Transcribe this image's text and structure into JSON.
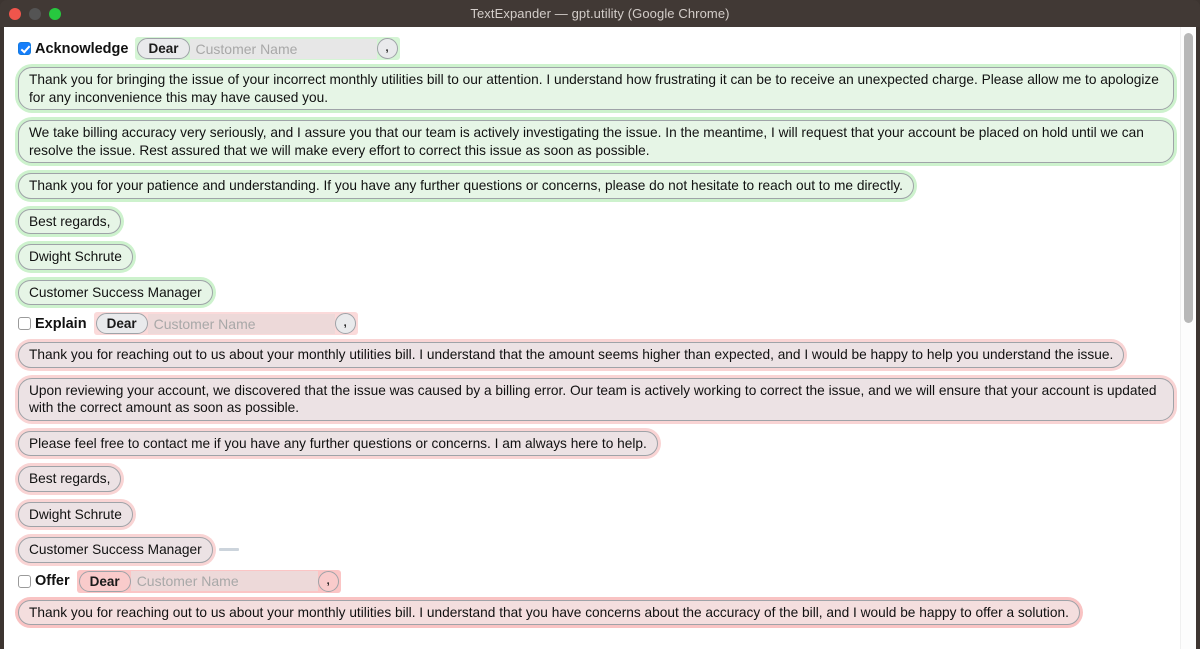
{
  "window": {
    "title": "TextExpander — gpt.utility (Google Chrome)",
    "controls": [
      "close",
      "minimize",
      "maximize"
    ]
  },
  "colors": {
    "titlebar_bg": "#413935",
    "accent_checkbox": "#157efb",
    "highlight_green": "#cdf2cd",
    "highlight_pink": "#f9c3c3",
    "bubble_bg": "#e9eaec"
  },
  "scrollbar": {
    "visible": true,
    "orientation": "vertical"
  },
  "sections": [
    {
      "id": "acknowledge",
      "label": "Acknowledge",
      "checked": true,
      "highlight": "green",
      "salutation": {
        "greeting_pill": "Dear",
        "name_placeholder": "Customer Name",
        "name_value": "",
        "punctuation_pill": ","
      },
      "has_trailing_dash": false,
      "blocks": [
        {
          "text": "Thank you for bringing the issue of your incorrect monthly utilities bill to our attention. I understand how frustrating it can be to receive an unexpected charge. Please allow me to apologize for any inconvenience this may have caused you.",
          "width": "full"
        },
        {
          "text": "We take billing accuracy very seriously, and I assure you that our team is actively investigating the issue. In the meantime, I will request that your account be placed on hold until we can resolve the issue. Rest assured that we will make every effort to correct this issue as soon as possible.",
          "width": "full"
        },
        {
          "text": "Thank you for your patience and understanding. If you have any further questions or concerns, please do not hesitate to reach out to me directly.",
          "width": "auto"
        },
        {
          "text": "Best regards,",
          "width": "auto"
        },
        {
          "text": "Dwight Schrute",
          "width": "auto"
        },
        {
          "text": "Customer Success Manager",
          "width": "auto"
        }
      ]
    },
    {
      "id": "explain",
      "label": "Explain",
      "checked": false,
      "highlight": "pink-light",
      "salutation": {
        "greeting_pill": "Dear",
        "name_placeholder": "Customer Name",
        "name_value": "",
        "punctuation_pill": ","
      },
      "has_trailing_dash": false,
      "blocks": [
        {
          "text": "Thank you for reaching out to us about your monthly utilities bill. I understand that the amount seems higher than expected, and I would be happy to help you understand the issue.",
          "width": "auto"
        },
        {
          "text": "Upon reviewing your account, we discovered that the issue was caused by a billing error. Our team is actively working to correct the issue, and we will ensure that your account is updated with the correct amount as soon as possible.",
          "width": "full"
        },
        {
          "text": "Please feel free to contact me if you have any further questions or concerns. I am always here to help.",
          "width": "auto"
        },
        {
          "text": "Best regards,",
          "width": "auto"
        },
        {
          "text": "Dwight Schrute",
          "width": "auto"
        },
        {
          "text": "Customer Success Manager",
          "width": "auto",
          "trailing_dash": true
        }
      ]
    },
    {
      "id": "offer",
      "label": "Offer",
      "checked": false,
      "highlight": "pink",
      "salutation": {
        "greeting_pill": "Dear",
        "name_placeholder": "Customer Name",
        "name_value": "",
        "punctuation_pill": ","
      },
      "has_trailing_dash": false,
      "blocks": [
        {
          "text": "Thank you for reaching out to us about your monthly utilities bill. I understand that you have concerns about the accuracy of the bill, and I would be happy to offer a solution.",
          "width": "auto"
        }
      ]
    }
  ]
}
